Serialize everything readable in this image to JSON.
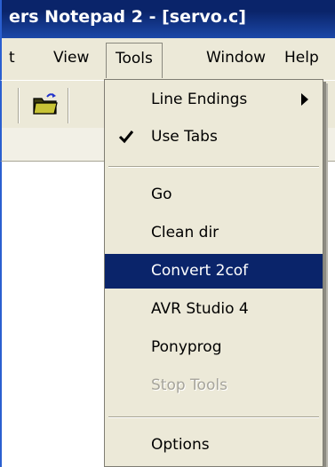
{
  "window": {
    "title_fragment": "ers Notepad 2 - [servo.c]"
  },
  "menubar": {
    "items": [
      "t",
      "View",
      "Tools",
      "Window",
      "Help"
    ]
  },
  "tools_menu": {
    "items": [
      {
        "label": "Line Endings"
      },
      {
        "label": "Use Tabs"
      },
      {
        "label": "Go"
      },
      {
        "label": "Clean dir"
      },
      {
        "label": "Convert 2cof"
      },
      {
        "label": "AVR Studio 4"
      },
      {
        "label": "Ponyprog"
      },
      {
        "label": "Stop Tools"
      },
      {
        "label": "Options"
      }
    ]
  },
  "colors": {
    "title_bar": "#0a246a",
    "highlight": "#0a246a",
    "menu_bg": "#ece9d8"
  },
  "icons": [
    "folder-icon",
    "check-icon",
    "submenu-arrow-icon"
  ]
}
